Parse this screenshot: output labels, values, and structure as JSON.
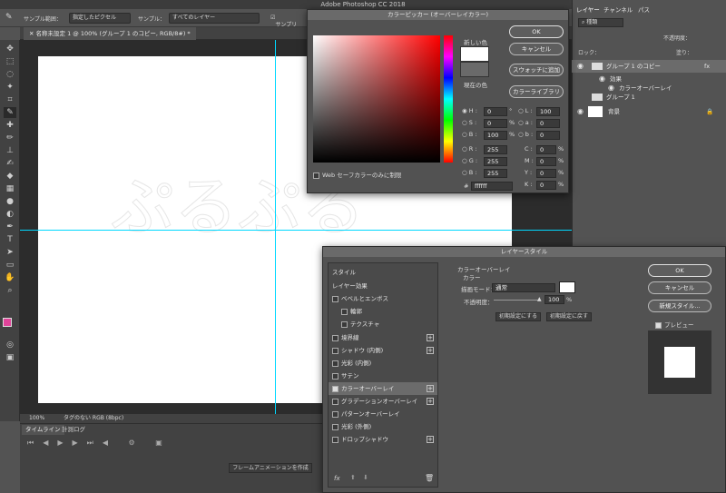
{
  "app": {
    "title": "Adobe Photoshop CC 2018"
  },
  "options": {
    "sample_size_label": "サンプル範囲：",
    "sample_size_value": "指定したピクセル",
    "sample_label": "サンプル：",
    "sample_value": "すべてのレイヤー",
    "sample_ring_label": "サンプリ"
  },
  "document": {
    "tab": "名称未設定 1 @ 100% (グループ 1 のコピー, RGB/8#) *",
    "zoom": "100%",
    "status": "タグのない RGB (8bpc)"
  },
  "timeline": {
    "tab_timeline": "タイムライン",
    "tab_log": "計測ログ",
    "create_button": "フレームアニメーションを作成"
  },
  "layers_panel": {
    "tabs": [
      "レイヤー",
      "チャンネル",
      "パス"
    ],
    "filter": "種類",
    "opacity_label": "不透明度：",
    "fill_label": "塗り：",
    "lock_label": "ロック：",
    "layers": [
      {
        "name": "グループ 1 のコピー",
        "fx": "fx"
      },
      {
        "name": "効果"
      },
      {
        "name": "カラーオーバーレイ"
      },
      {
        "name": "グループ 1"
      },
      {
        "name": "背景"
      }
    ]
  },
  "color_picker": {
    "title": "カラーピッカー (オーバーレイカラー)",
    "new_label": "新しい色",
    "current_label": "現在の色",
    "ok": "OK",
    "cancel": "キャンセル",
    "add_swatch": "スウォッチに追加",
    "libraries": "カラーライブラリ",
    "web_only": "Web セーフカラーのみに制限",
    "hsb": [
      {
        "k": "H :",
        "v": "0",
        "u": "°"
      },
      {
        "k": "S :",
        "v": "0",
        "u": "%"
      },
      {
        "k": "B :",
        "v": "100",
        "u": "%"
      }
    ],
    "rgb": [
      {
        "k": "R :",
        "v": "255"
      },
      {
        "k": "G :",
        "v": "255"
      },
      {
        "k": "B :",
        "v": "255"
      }
    ],
    "lab": [
      {
        "k": "L :",
        "v": "100"
      },
      {
        "k": "a :",
        "v": "0"
      },
      {
        "k": "b :",
        "v": "0"
      }
    ],
    "cmyk": [
      {
        "k": "C :",
        "v": "0",
        "u": "%"
      },
      {
        "k": "M :",
        "v": "0",
        "u": "%"
      },
      {
        "k": "Y :",
        "v": "0",
        "u": "%"
      },
      {
        "k": "K :",
        "v": "0",
        "u": "%"
      }
    ],
    "hex_label": "#",
    "hex": "ffffff"
  },
  "layer_style": {
    "title": "レイヤースタイル",
    "items": [
      "スタイル",
      "レイヤー効果",
      "ベベルとエンボス",
      "輪郭",
      "テクスチャ",
      "境界線",
      "シャドウ (内側)",
      "光彩 (内側)",
      "サテン",
      "カラーオーバーレイ",
      "グラデーションオーバーレイ",
      "パターンオーバーレイ",
      "光彩 (外側)",
      "ドロップシャドウ"
    ],
    "section_title": "カラーオーバーレイ",
    "group_label": "カラー",
    "blend_label": "描画モード：",
    "blend_value": "通常",
    "opacity_label": "不透明度：",
    "opacity_value": "100",
    "opacity_unit": "%",
    "set_default": "初期設定にする",
    "reset_default": "初期設定に戻す",
    "ok": "OK",
    "cancel": "キャンセル",
    "new_style": "新規スタイル...",
    "preview": "プレビュー",
    "fx": "fx"
  },
  "colors": {
    "accent": "#e0449a",
    "guide": "#00d8ff",
    "panel": "#535353",
    "dialog": "#525252"
  }
}
